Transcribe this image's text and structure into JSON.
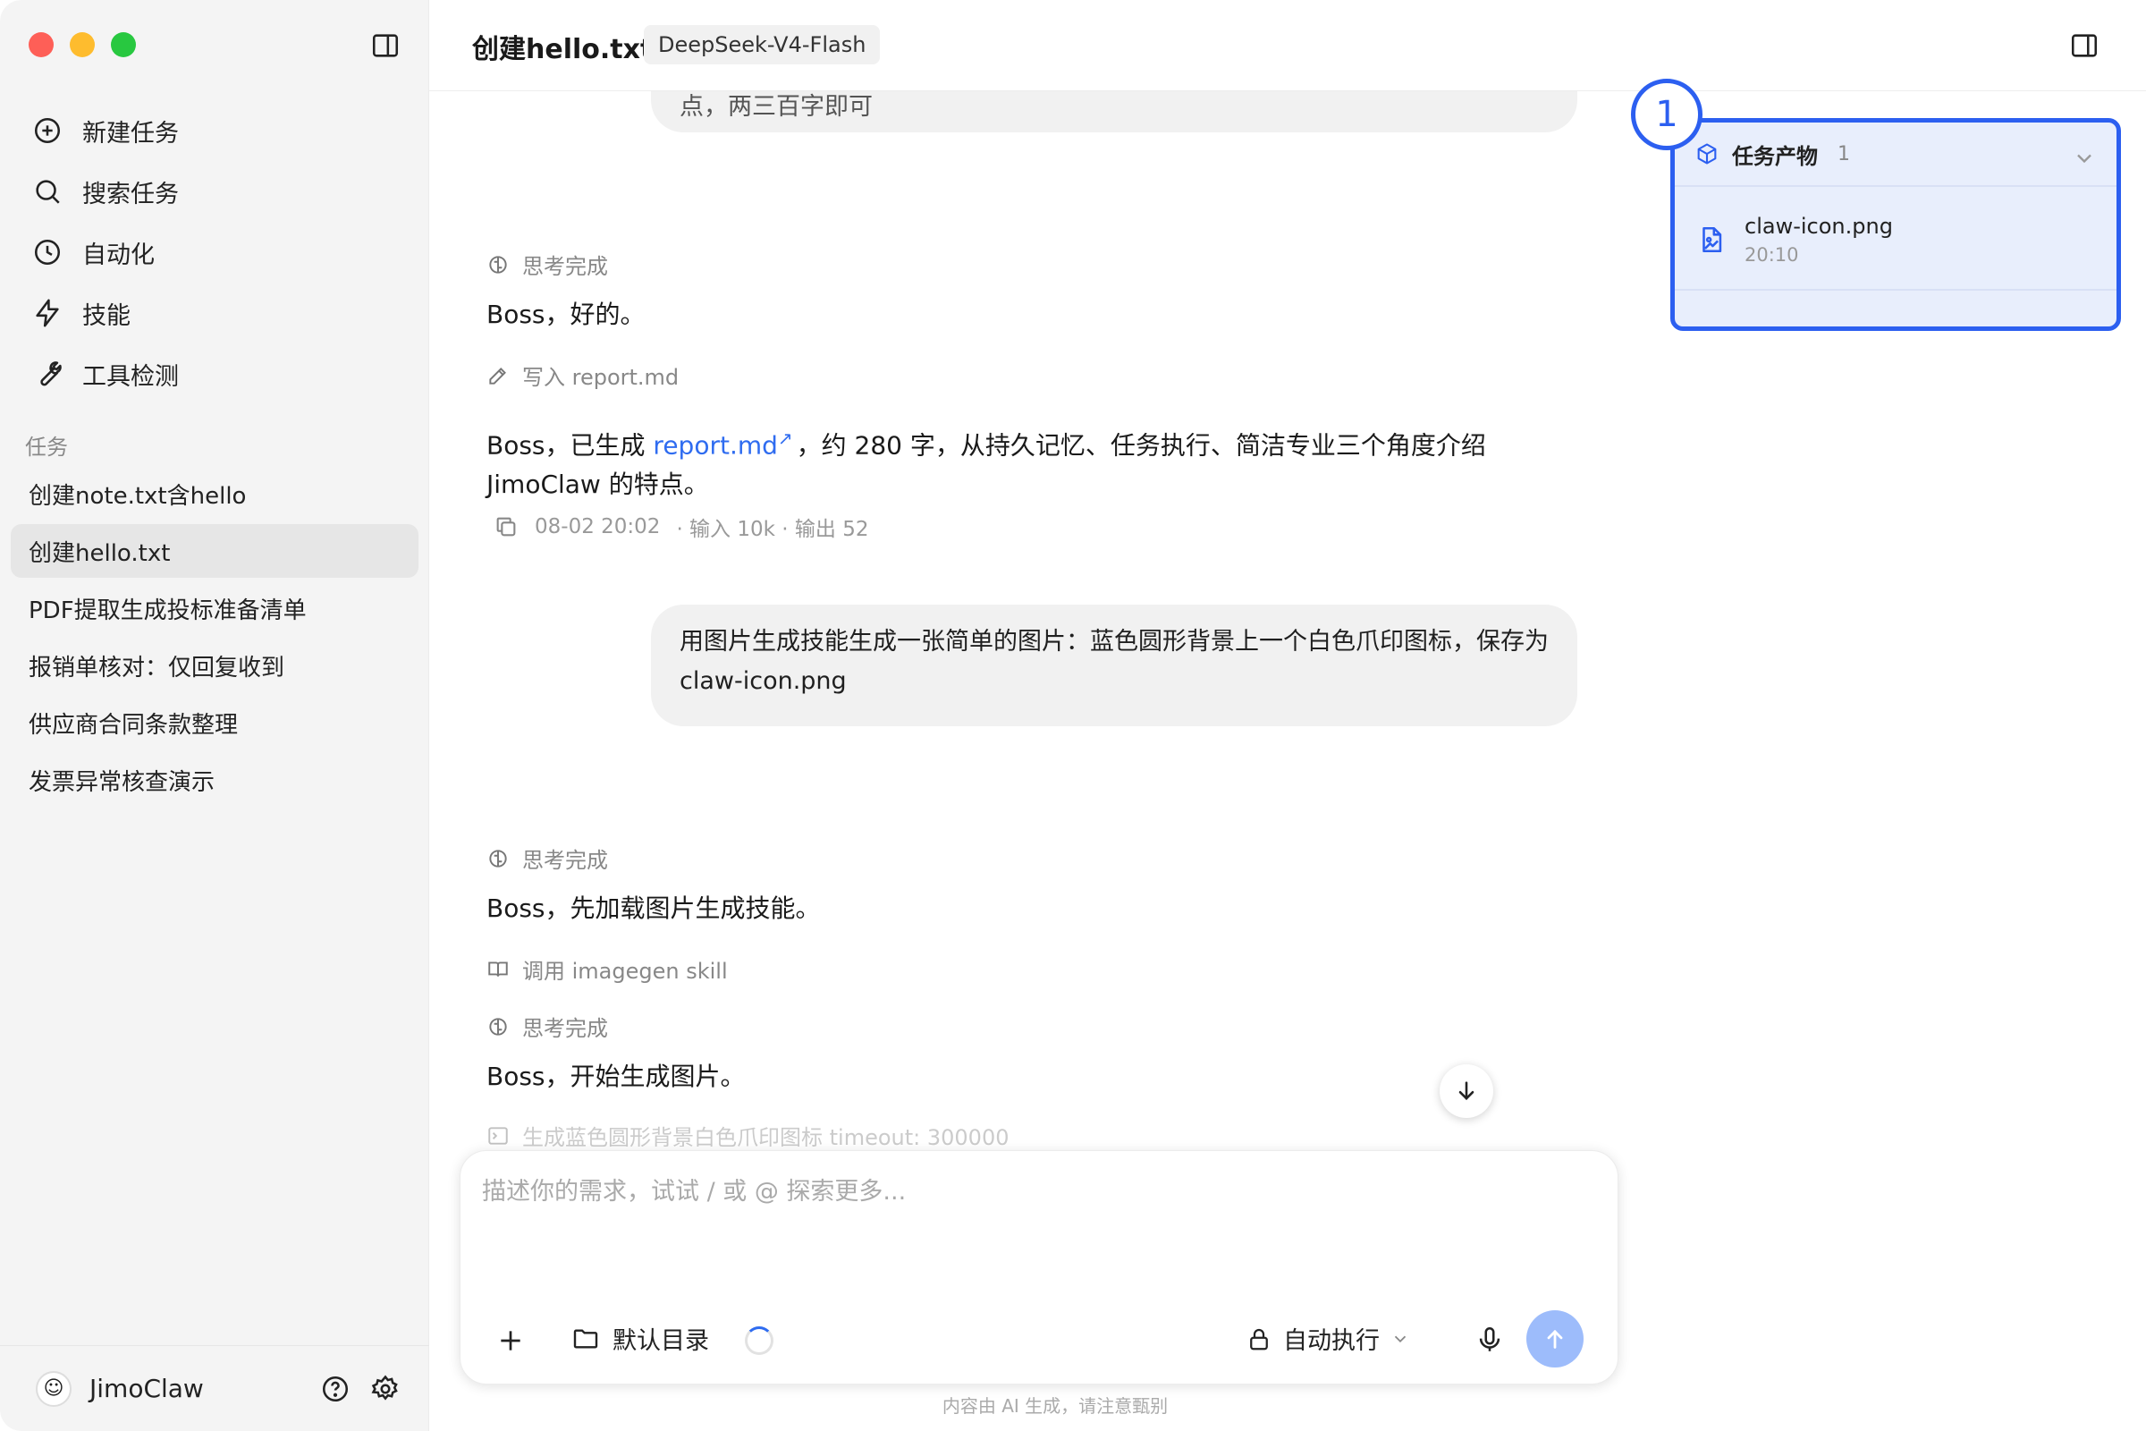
{
  "window": {
    "title": "创建hello.txt",
    "model": "DeepSeek-V4-Flash"
  },
  "sidebar": {
    "nav": [
      {
        "label": "新建任务",
        "icon": "plus-circle-icon"
      },
      {
        "label": "搜索任务",
        "icon": "search-icon"
      },
      {
        "label": "自动化",
        "icon": "clock-icon"
      },
      {
        "label": "技能",
        "icon": "lightning-icon"
      },
      {
        "label": "工具检测",
        "icon": "wrench-icon"
      }
    ],
    "section_label": "任务",
    "tasks": [
      "创建note.txt含hello",
      "创建hello.txt",
      "PDF提取生成投标准备清单",
      "报销单核对：仅回复收到",
      "供应商合同条款整理",
      "发票异常核查演示"
    ],
    "active_task": 1,
    "user": {
      "name": "JimoClaw"
    }
  },
  "chat": {
    "top_bubble_fragment": "点，两三百字即可",
    "think1": "思考完成",
    "reply1": "Boss，好的。",
    "tool_write": "写入 report.md",
    "reply2_pre": "Boss，已生成 ",
    "reply2_link": "report.md",
    "reply2_post": "，约 280 字，从持久记忆、任务执行、简洁专业三个角度介绍 JimoClaw 的特点。",
    "stats_time": "08-02 20:02",
    "stats_tokens": "· 输入 10k · 输出 52",
    "user_msg": "用图片生成技能生成一张简单的图片：蓝色圆形背景上一个白色爪印图标，保存为 claw-icon.png",
    "think2": "思考完成",
    "reply3": "Boss，先加载图片生成技能。",
    "tool_skill": "调用 imagegen skill",
    "think3": "思考完成",
    "reply4": "Boss，开始生成图片。",
    "tool_gen": "生成蓝色圆形背景白色爪印图标  timeout: 300000"
  },
  "composer": {
    "placeholder": "描述你的需求，试试 / 或 @ 探索更多...",
    "dir_label": "默认目录",
    "mode_label": "自动执行"
  },
  "disclaimer": "内容由 AI 生成，请注意甄别",
  "artifacts": {
    "title": "任务产物",
    "count": "1",
    "items": [
      {
        "name": "claw-icon.png",
        "time": "20:10"
      }
    ]
  },
  "marker": "1",
  "colors": {
    "accent": "#2c5ff0",
    "link": "#2f6cf0",
    "send": "#9dbcfb"
  }
}
